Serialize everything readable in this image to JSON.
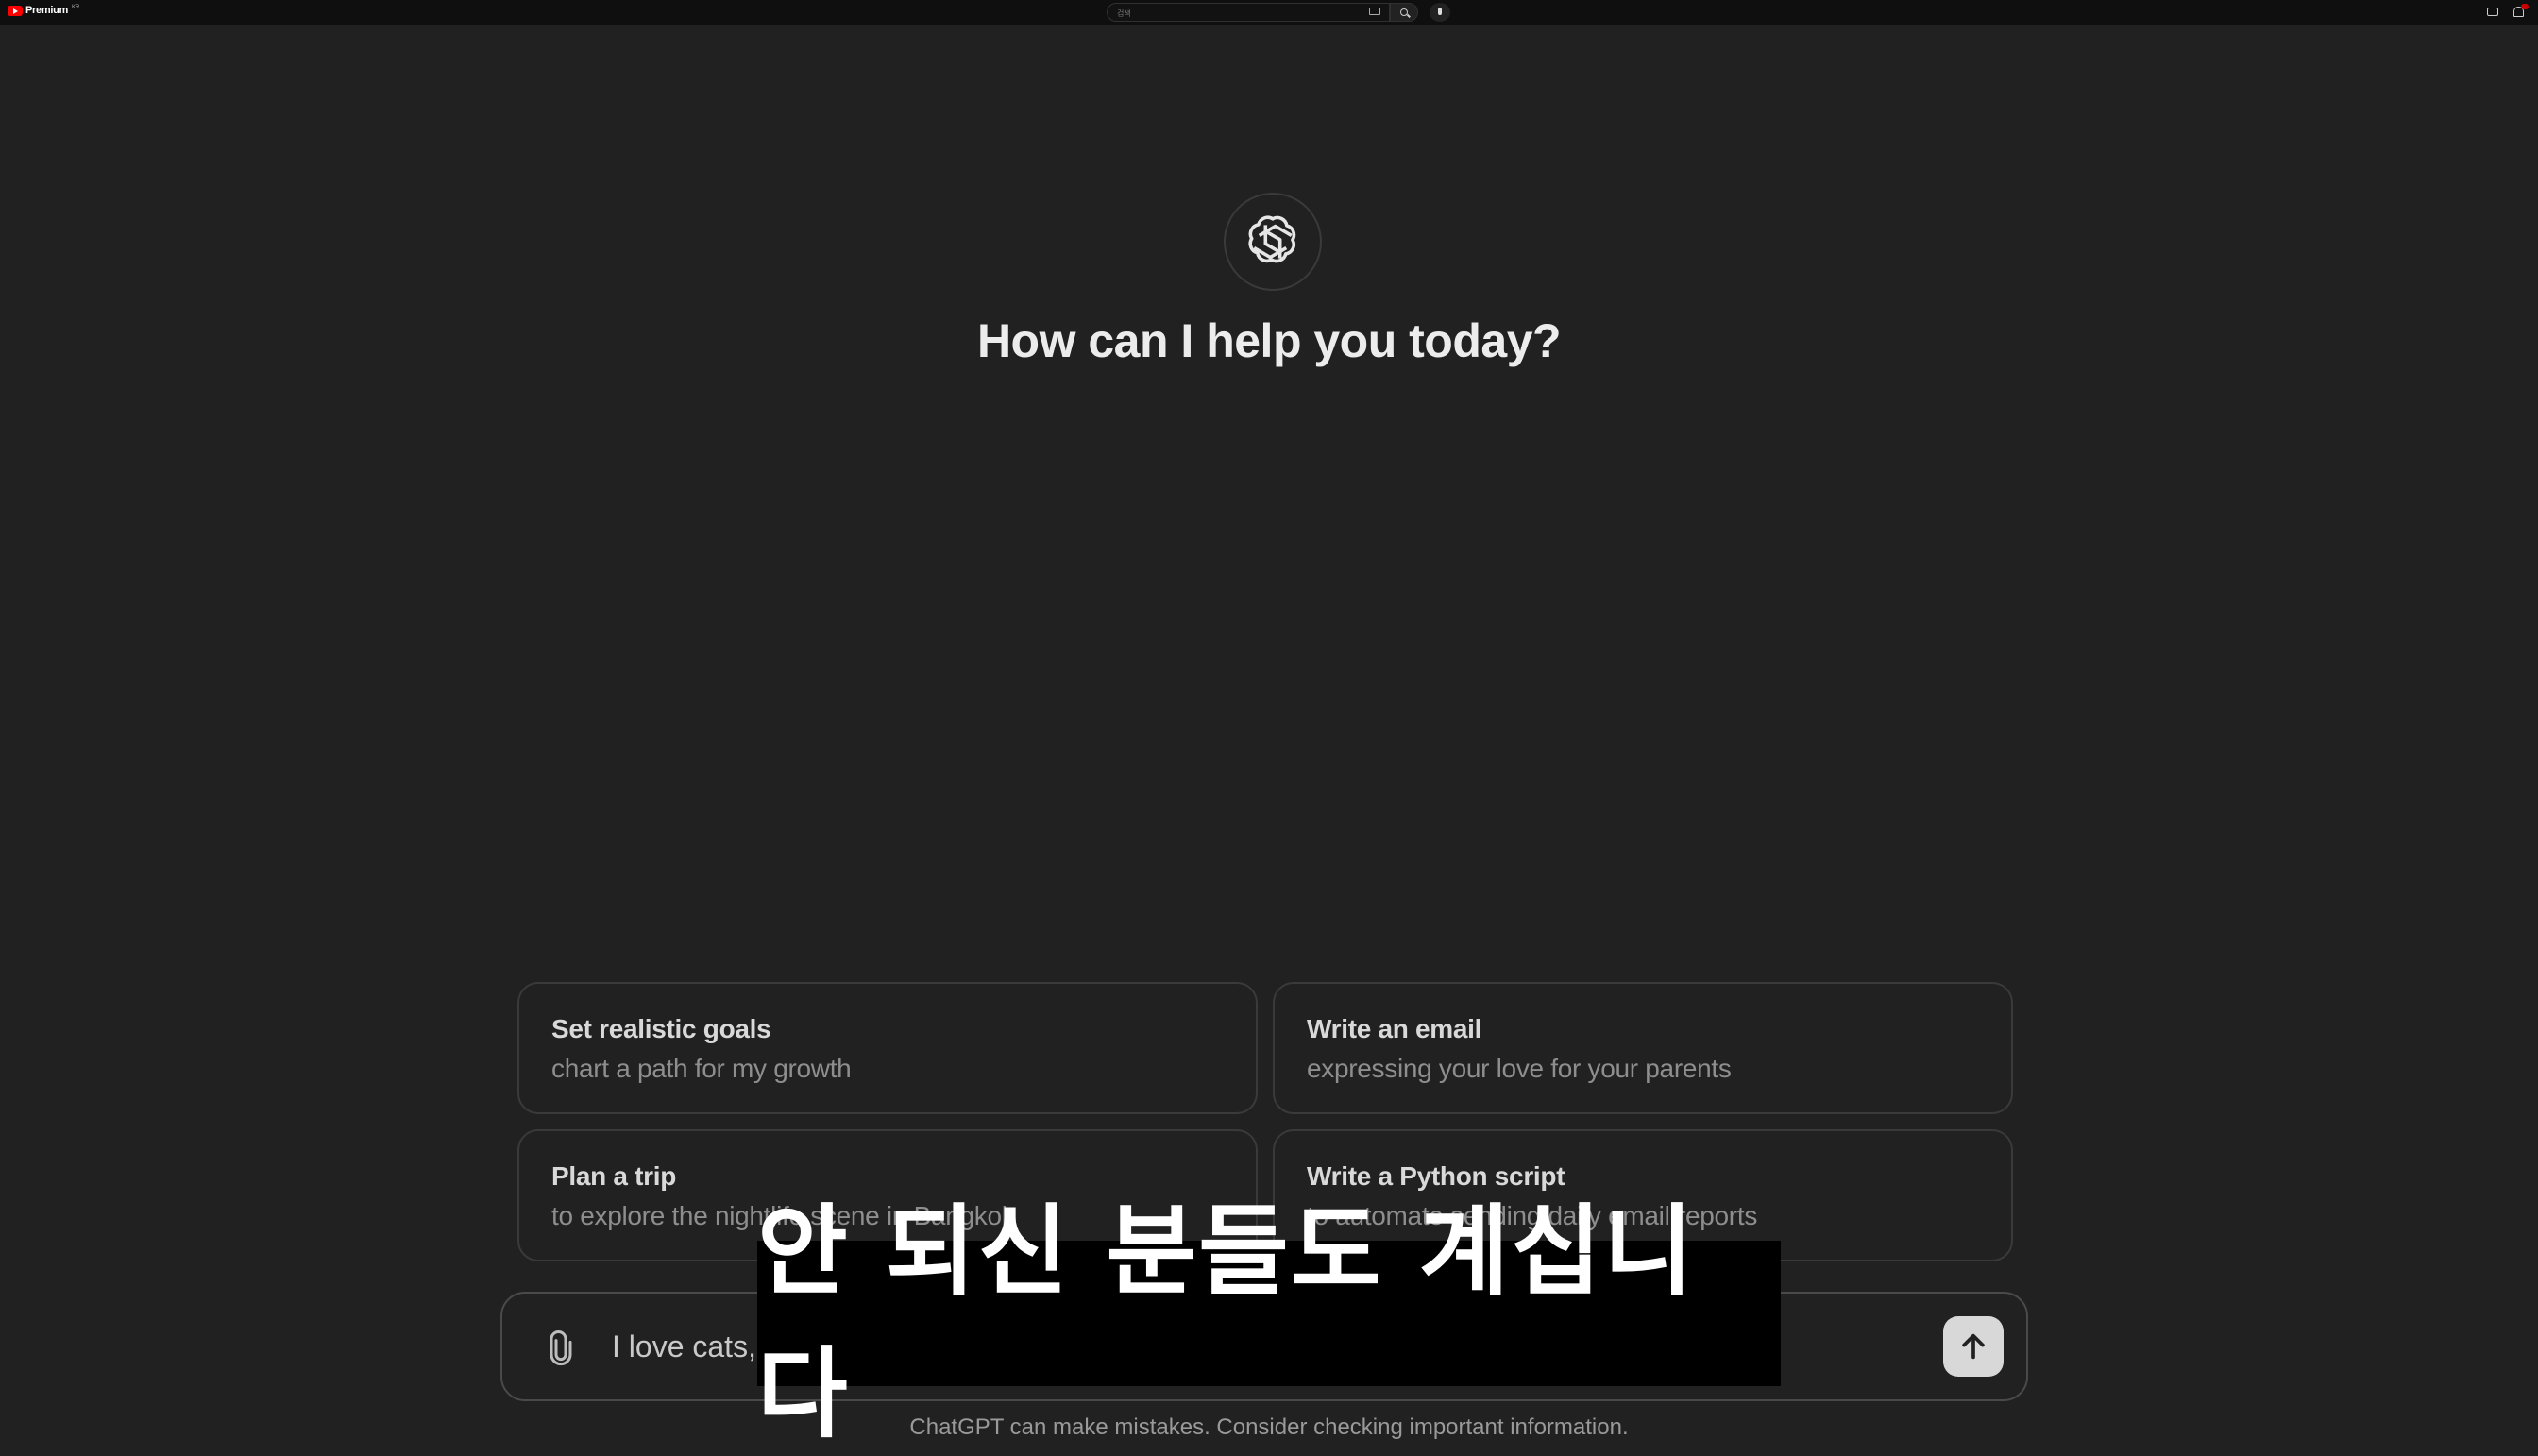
{
  "topbar": {
    "brand": "Premium",
    "brand_suffix": "KR",
    "search_placeholder": "검색",
    "icons": [
      "youtube-logo",
      "keyboard-icon",
      "search-icon",
      "mic-icon",
      "create-icon",
      "notification-icon"
    ]
  },
  "main": {
    "headline": "How can I help you today?",
    "logo_icon": "openai-logo"
  },
  "suggestions": [
    {
      "title": "Set realistic goals",
      "subtitle": "chart a path for my growth"
    },
    {
      "title": "Write an email",
      "subtitle": "expressing your love for your parents"
    },
    {
      "title": "Plan a trip",
      "subtitle": "to explore the nightlife scene in Bangkok"
    },
    {
      "title": "Write a Python script",
      "subtitle": "to automate sending daily email reports"
    }
  ],
  "composer": {
    "value": "I love cats,",
    "attach_icon": "paperclip-icon",
    "send_icon": "arrow-up-icon"
  },
  "caption": {
    "text": "안 되신 분들도 계십니다"
  },
  "footer": {
    "disclaimer": "ChatGPT can make mistakes. Consider checking important information."
  },
  "colors": {
    "background": "#212121",
    "card_border": "#3a3a3a",
    "title_text": "#ececec",
    "muted_text": "#8e8e8e",
    "send_button": "#d8d8d8",
    "caption_bg": "#000000"
  }
}
